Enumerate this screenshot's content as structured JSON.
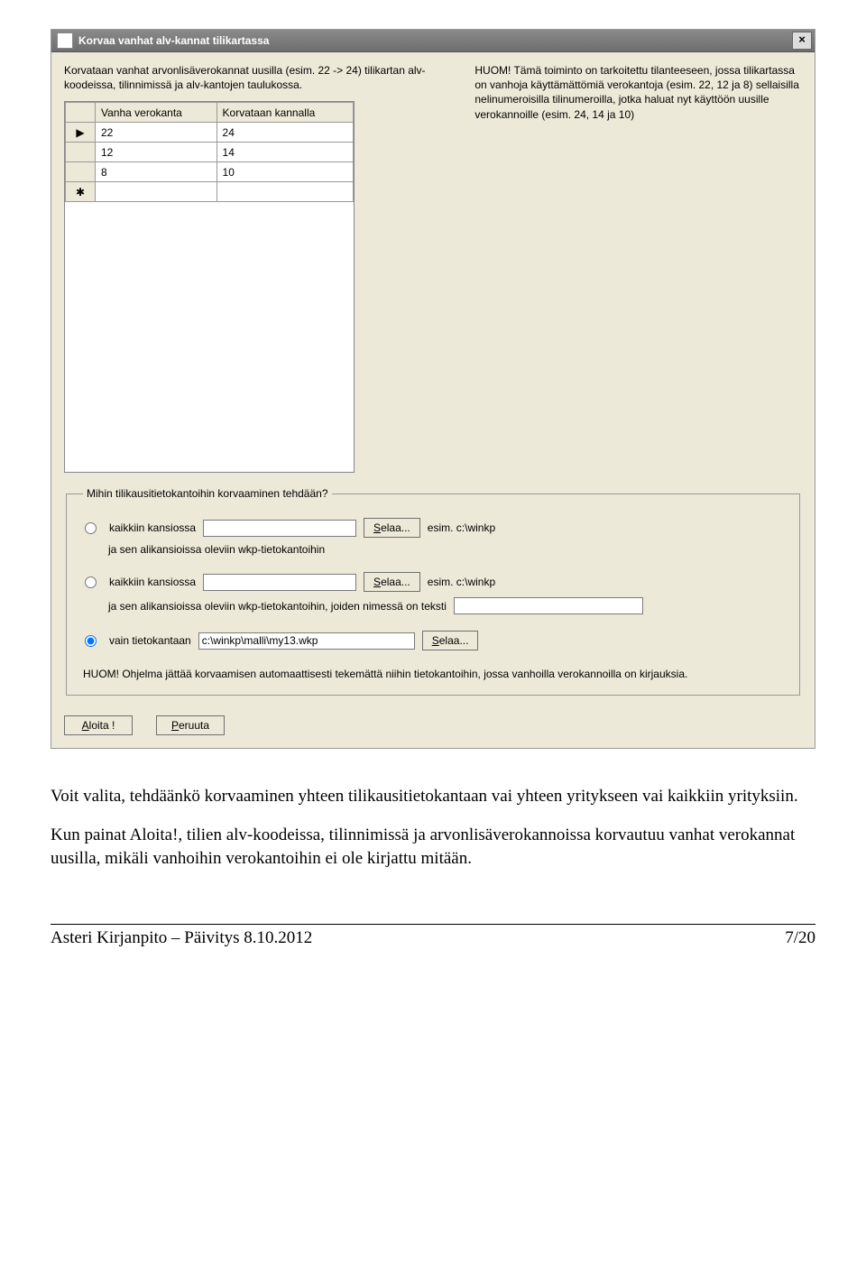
{
  "window": {
    "title": "Korvaa vanhat alv-kannat tilikartassa",
    "close_glyph": "×"
  },
  "top": {
    "left_text": "Korvataan vanhat arvonlisäverokannat uusilla (esim. 22 -> 24) tilikartan alv-koodeissa, tilinnimissä ja alv-kantojen taulukossa.",
    "right_text": "HUOM! Tämä toiminto on tarkoitettu tilanteeseen, jossa tilikartassa on vanhoja käyttämättömiä verokantoja (esim. 22, 12 ja 8) sellaisilla nelinumeroisilla tilinumeroilla, jotka haluat nyt käyttöön uusille verokannoille (esim. 24, 14 ja 10)"
  },
  "grid": {
    "headers": [
      "Vanha verokanta",
      "Korvataan kannalla"
    ],
    "rows": [
      {
        "a": "22",
        "b": "24"
      },
      {
        "a": "12",
        "b": "14"
      },
      {
        "a": "8",
        "b": "10"
      }
    ],
    "newrow_glyph": "✱"
  },
  "fieldset": {
    "legend": "Mihin tilikausitietokantoihin korvaaminen tehdään?",
    "opt1_label": "kaikkiin kansiossa",
    "opt1_sub": "ja sen alikansioissa oleviin wkp-tietokantoihin",
    "opt2_label": "kaikkiin kansiossa",
    "opt2_sub": "ja sen alikansioissa oleviin wkp-tietokantoihin, joiden nimessä on teksti",
    "opt3_label": "vain tietokantaan",
    "opt3_value": "c:\\winkp\\malli\\my13.wkp",
    "browse_label_S": "S",
    "browse_label_rest": "elaa...",
    "example": "esim. c:\\winkp",
    "note": "HUOM! Ohjelma jättää korvaamisen automaattisesti tekemättä niihin tietokantoihin, jossa vanhoilla verokannoilla on kirjauksia."
  },
  "buttons": {
    "start_A": "A",
    "start_rest": "loita !",
    "cancel_P": "P",
    "cancel_rest": "eruuta"
  },
  "doc": {
    "para1": "Voit valita, tehdäänkö korvaaminen yhteen tilikausitietokantaan vai yhteen yritykseen vai kaikkiin yrityksiin.",
    "para2": "Kun painat Aloita!, tilien alv-koodeissa, tilinnimissä ja arvonlisäverokannoissa korvautuu vanhat verokannat uusilla, mikäli vanhoihin verokantoihin ei ole kirjattu mitään.",
    "footer_left": "Asteri Kirjanpito – Päivitys 8.10.2012",
    "footer_right": "7/20"
  }
}
